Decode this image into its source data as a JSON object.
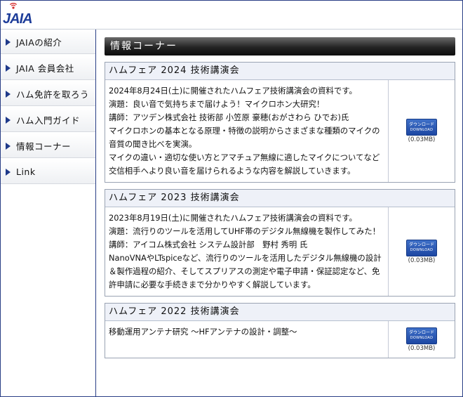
{
  "site": {
    "logo_text": "JAIA"
  },
  "sidebar": {
    "items": [
      {
        "label": "JAIAの紹介"
      },
      {
        "label": "JAIA 会員会社"
      },
      {
        "label": "ハム免許を取ろう"
      },
      {
        "label": "ハム入門ガイド"
      },
      {
        "label": "情報コーナー"
      },
      {
        "label": "Link"
      }
    ]
  },
  "main": {
    "section_title": "情報コーナー",
    "posts": [
      {
        "title": "ハムフェア 2024 技術講演会",
        "lines": [
          "2024年8月24日(土)に開催されたハムフェア技術講演会の資料です。",
          "演題：良い音で気持ちまで届けよう！マイクロホン大研究！",
          "講師：アツデン株式会社 技術部 小笠原 豪穂(おがさわら ひでお)氏",
          "マイクロホンの基本となる原理・特徴の説明からさまざまな種類のマイクの音質の聞き比べを実演。",
          "マイクの違い・適切な使い方とアマチュア無線に適したマイクについてなど交信相手へより良い音を届けられるような内容を解説していきます。"
        ],
        "download": {
          "label_ja": "ダウンロード",
          "label_en": "DOWNLOAD",
          "size": "(0.03MB)"
        }
      },
      {
        "title": "ハムフェア 2023 技術講演会",
        "lines": [
          "2023年8月19日(土)に開催されたハムフェア技術講演会の資料です。",
          "演題：流行りのツールを活用してUHF帯のデジタル無線機を製作してみた！",
          "講師：アイコム株式会社 システム設計部　野村 秀明 氏",
          "NanoVNAやLTspiceなど、流行りのツールを活用したデジタル無線機の設計＆製作過程の紹介、そしてスプリアスの測定や電子申請・保証認定など、免許申請に必要な手続きまで分かりやすく解説しています。"
        ],
        "download": {
          "label_ja": "ダウンロード",
          "label_en": "DOWNLOAD",
          "size": "(0.03MB)"
        }
      },
      {
        "title": "ハムフェア 2022 技術講演会",
        "lines": [
          "移動運用アンテナ研究 ～HFアンテナの設計・調整～"
        ],
        "download": {
          "label_ja": "ダウンロード",
          "label_en": "DOWNLOAD",
          "size": "(0.03MB)"
        }
      }
    ]
  },
  "colors": {
    "brand": "#1f3e9a",
    "accent_red": "#d42b2b",
    "header_bar": "#232323",
    "post_head_bg": "#eef1f8"
  }
}
